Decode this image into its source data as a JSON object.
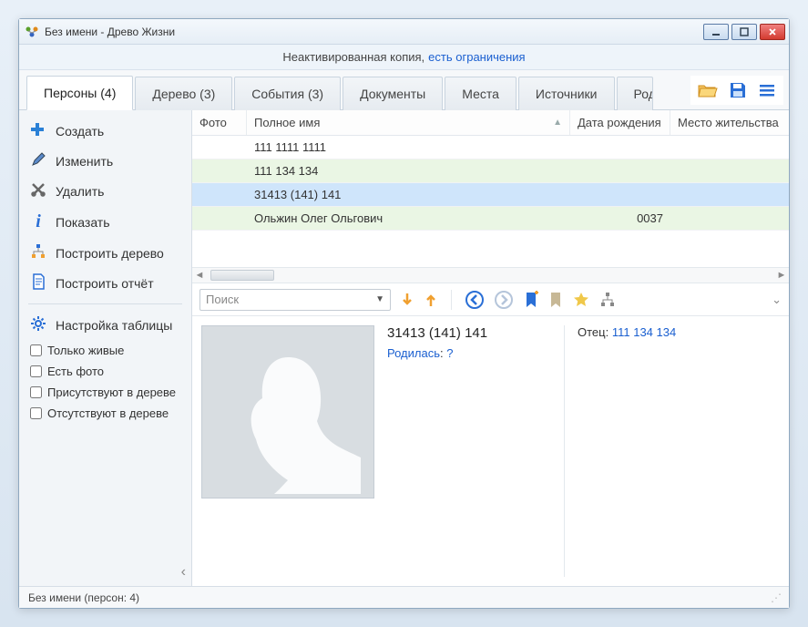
{
  "window": {
    "title": "Без имени - Древо Жизни"
  },
  "activation": {
    "text": "Неактивированная копия,",
    "link": "есть ограничения"
  },
  "tabs": [
    {
      "label": "Персоны (4)",
      "active": true
    },
    {
      "label": "Дерево (3)"
    },
    {
      "label": "События (3)"
    },
    {
      "label": "Документы"
    },
    {
      "label": "Места"
    },
    {
      "label": "Источники"
    },
    {
      "label": "Роды"
    }
  ],
  "sidebar": {
    "create": "Создать",
    "edit": "Изменить",
    "delete": "Удалить",
    "show": "Показать",
    "build_tree": "Построить дерево",
    "build_report": "Построить отчёт",
    "table_settings": "Настройка таблицы",
    "filters": {
      "alive_only": "Только живые",
      "has_photo": "Есть фото",
      "in_tree": "Присутствуют в дереве",
      "not_in_tree": "Отсутствуют в дереве"
    }
  },
  "grid": {
    "columns": {
      "photo": "Фото",
      "full_name": "Полное имя",
      "birth_date": "Дата рождения",
      "residence": "Место жительства"
    },
    "rows": [
      {
        "photo": "",
        "full_name": "111 1111 1111",
        "birth_date": "",
        "residence": "",
        "style": ""
      },
      {
        "photo": "",
        "full_name": "111 134 134",
        "birth_date": "",
        "residence": "",
        "style": "alt-green"
      },
      {
        "photo": "",
        "full_name": "31413 (141) 141",
        "birth_date": "",
        "residence": "",
        "style": "selected"
      },
      {
        "photo": "",
        "full_name": "Ольжин Олег Ольгович",
        "birth_date": "0037",
        "residence": "",
        "style": "alt-green"
      }
    ]
  },
  "search": {
    "placeholder": "Поиск"
  },
  "detail": {
    "name": "31413 (141) 141",
    "born_label": "Родилась",
    "born_value": "?",
    "father_label": "Отец:",
    "father_name": "111 134 134"
  },
  "status": {
    "text": "Без имени (персон: 4)"
  },
  "icons": {
    "create": "plus-icon",
    "edit": "pencil-icon",
    "delete": "scissors-icon",
    "show": "info-icon",
    "build_tree": "tree-icon",
    "build_report": "document-icon",
    "settings": "gear-icon",
    "open": "folder-open-icon",
    "save": "floppy-icon",
    "menu": "hamburger-icon",
    "down": "arrow-down-icon",
    "up": "arrow-up-icon",
    "back": "nav-back-icon",
    "forward": "nav-forward-icon",
    "bookmark_add": "bookmark-add-icon",
    "bookmark": "bookmark-icon",
    "star": "star-icon",
    "tree_small": "tree-small-icon",
    "expand": "chevron-down-icon"
  },
  "colors": {
    "link": "#1a5fd0",
    "selected_row": "#cfe5fb",
    "alt_row": "#eaf6e4",
    "accent_blue": "#2a6fd6",
    "accent_orange": "#f0a030"
  }
}
